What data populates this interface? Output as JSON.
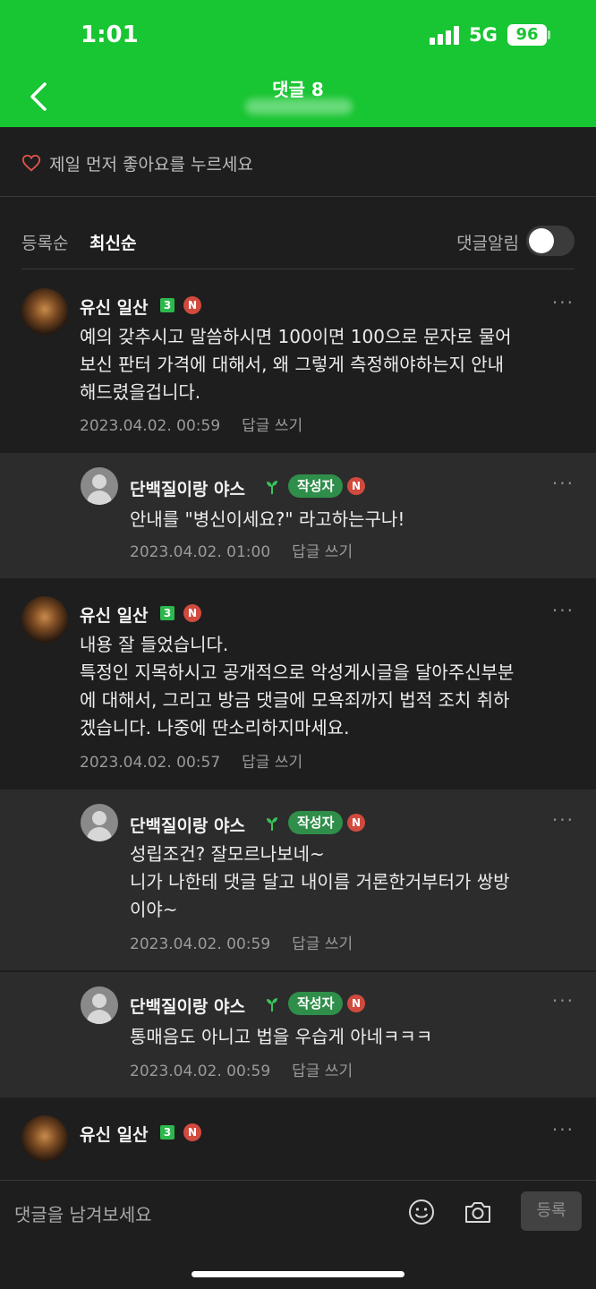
{
  "status_bar": {
    "time": "1:01",
    "network": "5G",
    "battery": "96"
  },
  "header": {
    "title": "댓글 8"
  },
  "like_prompt": "제일 먼저 좋아요를 누르세요",
  "sort": {
    "option_registered": "등록순",
    "option_latest": "최신순",
    "notify_label": "댓글알림",
    "notify_on": false
  },
  "comments": [
    {
      "nickname": "유신 일산",
      "level": "3",
      "body": "예의 갖추시고 말씀하시면 100이면 100으로 문자로 물어\n보신 판터 가격에 대해서, 왜 그렇게 측정해야하는지 안내\n해드렸을겁니다.",
      "date": "2023.04.02. 00:59",
      "reply_label": "답글 쓰기"
    },
    {
      "nickname": "단백질이랑 야스",
      "author_badge": "작성자",
      "body": "안내를 \"병신이세요?\" 라고하는구나!",
      "date": "2023.04.02. 01:00",
      "reply_label": "답글 쓰기"
    },
    {
      "nickname": "유신 일산",
      "level": "3",
      "body": "내용 잘 들었습니다.\n특정인 지목하시고 공개적으로 악성게시글을 달아주신부분\n에 대해서, 그리고 방금 댓글에 모욕죄까지 법적 조치 취하\n겠습니다. 나중에 딴소리하지마세요.",
      "date": "2023.04.02. 00:57",
      "reply_label": "답글 쓰기"
    },
    {
      "nickname": "단백질이랑 야스",
      "author_badge": "작성자",
      "body": "성립조건? 잘모르나보네~\n니가 나한테 댓글 달고 내이름 거론한거부터가 쌍방\n이야~",
      "date": "2023.04.02. 00:59",
      "reply_label": "답글 쓰기"
    },
    {
      "nickname": "단백질이랑 야스",
      "author_badge": "작성자",
      "body": "통매음도 아니고 법을 우습게 아네ㅋㅋㅋ",
      "date": "2023.04.02. 00:59",
      "reply_label": "답글 쓰기"
    },
    {
      "nickname": "유신 일산",
      "level": "3"
    }
  ],
  "n_badge": "N",
  "more_icon": "···",
  "input": {
    "placeholder": "댓글을 남겨보세요",
    "submit_label": "등록"
  },
  "colors": {
    "header_green": "#18c532",
    "background": "#1e1e1e",
    "reply_background": "#2c2c2c",
    "author_badge": "#2f8f4a",
    "n_badge": "#d14a3e"
  }
}
